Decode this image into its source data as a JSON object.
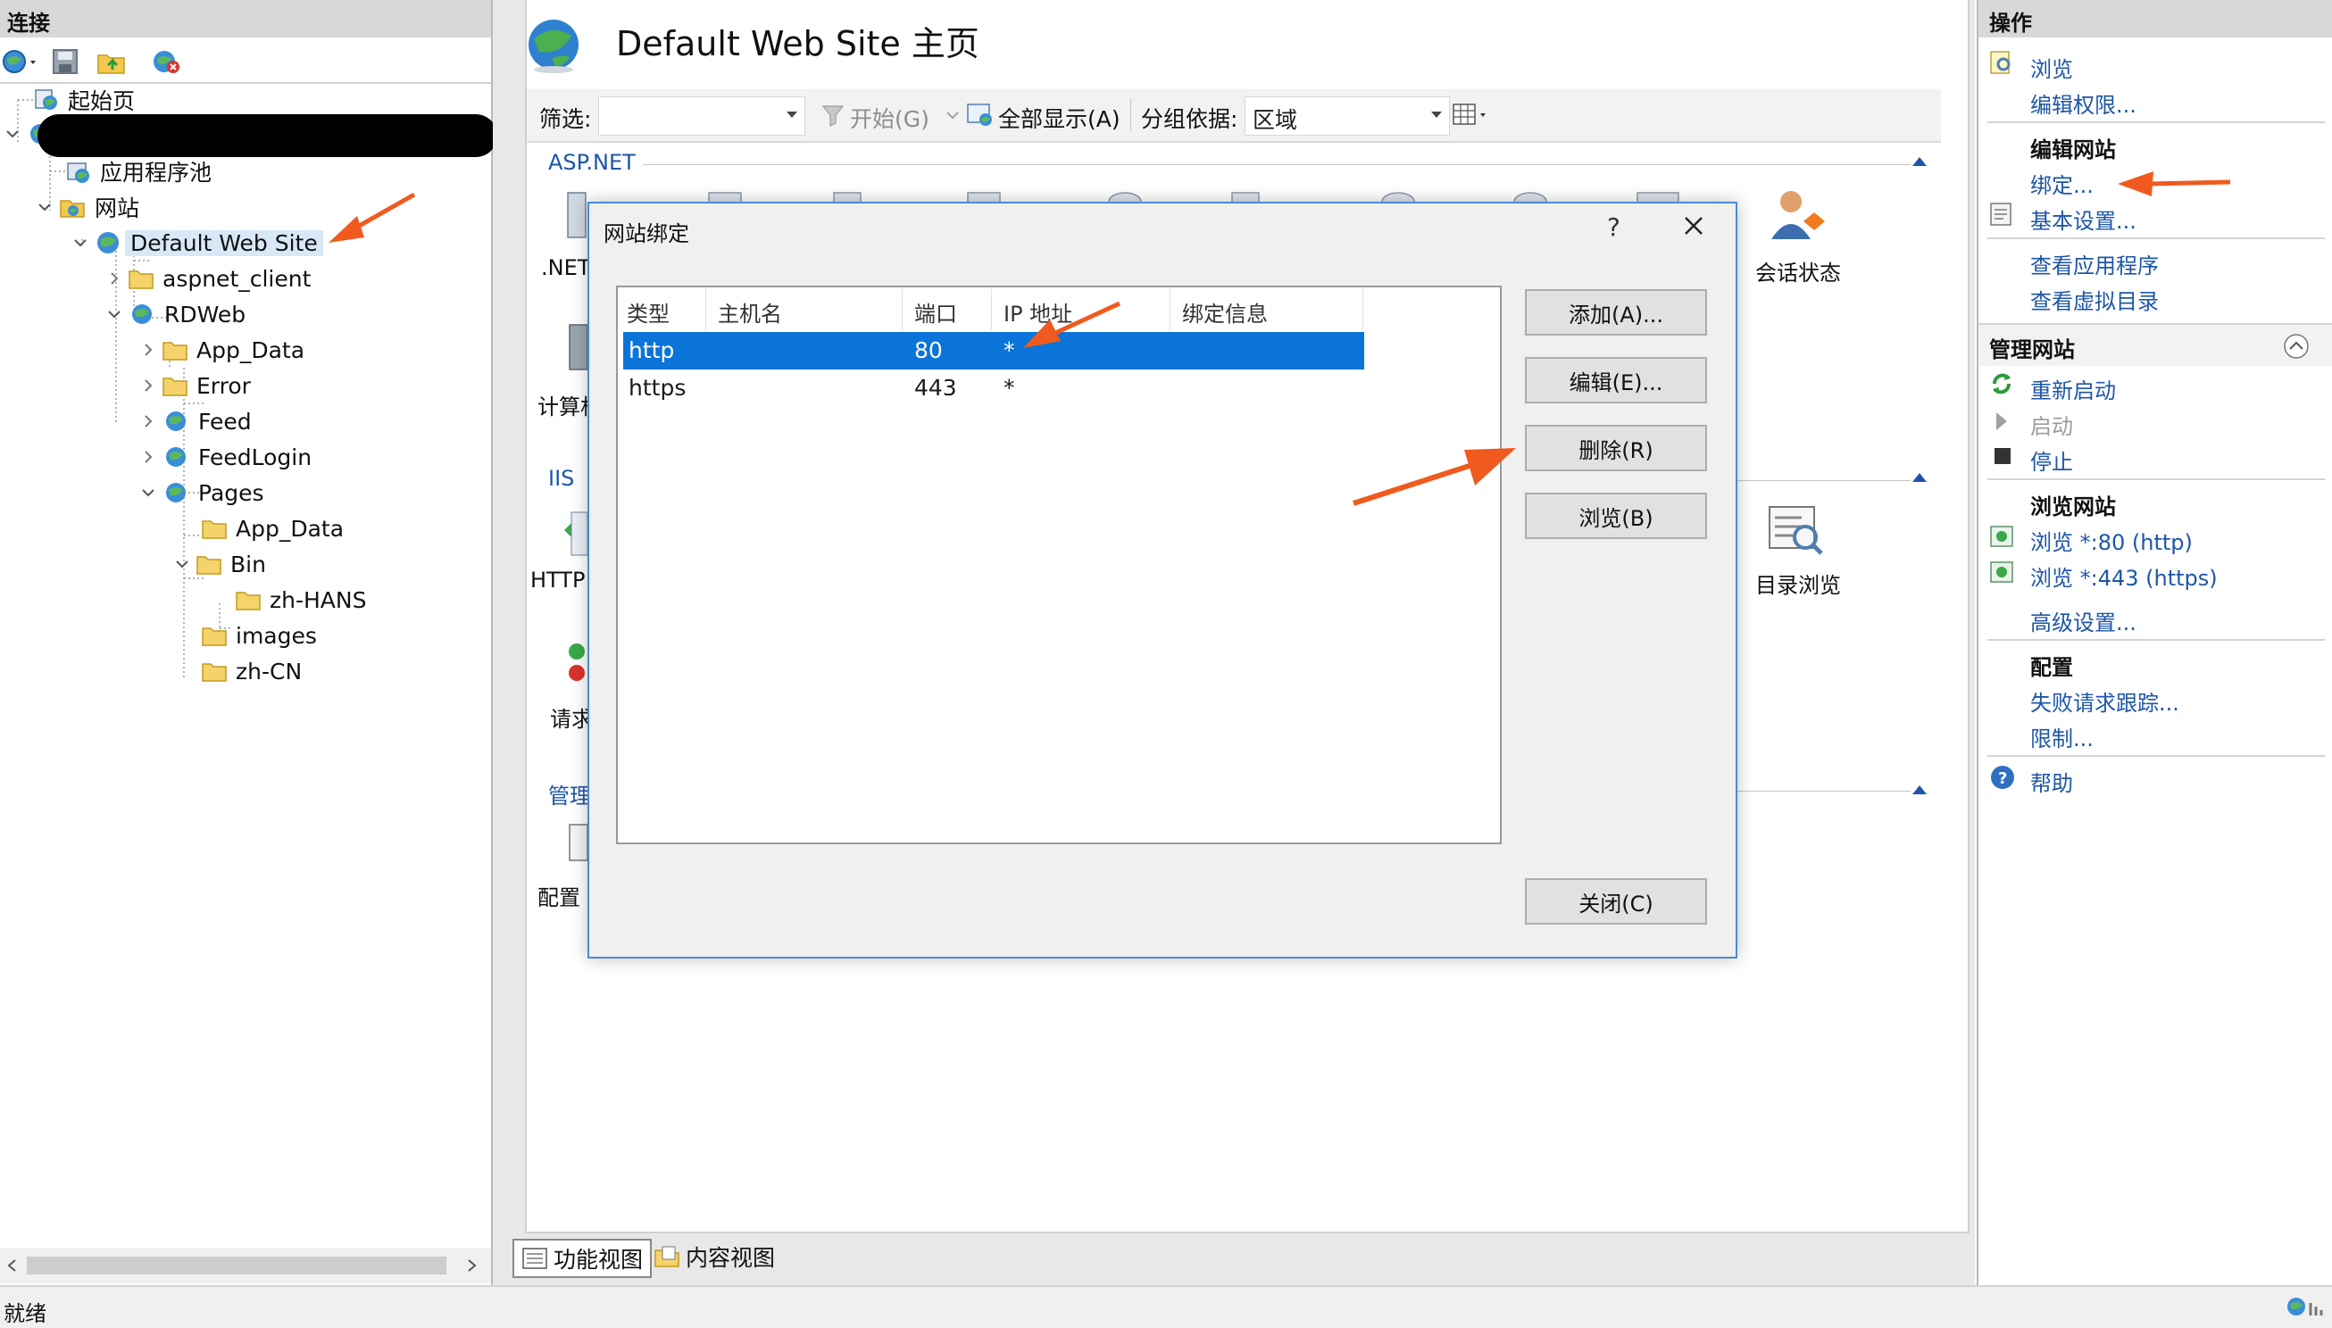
{
  "colors": {
    "accent_blue": "#1d56a8",
    "selection_blue": "#0a74d8",
    "annotation_arrow": "#f05a1e",
    "dialog_border": "#4a8ad8"
  },
  "left_pane": {
    "header": "连接",
    "tree": {
      "start_page": "起始页",
      "app_pools": "应用程序池",
      "sites": "网站",
      "default_site": "Default Web Site",
      "aspnet_client": "aspnet_client",
      "rdweb": "RDWeb",
      "app_data": "App_Data",
      "error": "Error",
      "feed": "Feed",
      "feedlogin": "FeedLogin",
      "pages": "Pages",
      "pages_app_data": "App_Data",
      "bin": "Bin",
      "zh_hans": "zh-HANS",
      "images": "images",
      "zh_cn": "zh-CN"
    }
  },
  "center": {
    "title": "Default Web Site 主页",
    "filter": {
      "label": "筛选:",
      "start": "开始(G)",
      "show_all": "全部显示(A)",
      "group_by_label": "分组依据:",
      "group_by_value": "区域"
    },
    "sections": {
      "aspnet": "ASP.NET",
      "iis": "IIS",
      "management": "管理"
    },
    "features": {
      "net_partial": ".NET",
      "computer_partial": "计算机",
      "session_state": "会话状态",
      "http_partial": "HTTP",
      "dir_browse": "目录浏览",
      "request_partial": "请求",
      "config_partial": "配置"
    },
    "bottom_tabs": {
      "feature_view": "功能视图",
      "content_view": "内容视图"
    }
  },
  "right_pane": {
    "header": "操作",
    "browse": "浏览",
    "edit_permissions": "编辑权限...",
    "edit_site_head": "编辑网站",
    "bindings": "绑定...",
    "basic_settings": "基本设置...",
    "view_apps": "查看应用程序",
    "view_vdirs": "查看虚拟目录",
    "manage_site_head": "管理网站",
    "restart": "重新启动",
    "start": "启动",
    "stop": "停止",
    "browse_site_head": "浏览网站",
    "browse_80": "浏览 *:80 (http)",
    "browse_443": "浏览 *:443 (https)",
    "advanced_settings": "高级设置...",
    "config_head": "配置",
    "failed_request_tracing": "失败请求跟踪...",
    "limits": "限制...",
    "help": "帮助"
  },
  "dialog": {
    "title": "网站绑定",
    "help": "?",
    "columns": {
      "type": "类型",
      "host": "主机名",
      "port": "端口",
      "ip": "IP 地址",
      "info": "绑定信息"
    },
    "rows": [
      {
        "type": "http",
        "host": "",
        "port": "80",
        "ip": "*",
        "info": ""
      },
      {
        "type": "https",
        "host": "",
        "port": "443",
        "ip": "*",
        "info": ""
      }
    ],
    "buttons": {
      "add": "添加(A)...",
      "edit": "编辑(E)...",
      "remove": "删除(R)",
      "browse": "浏览(B)",
      "close": "关闭(C)"
    }
  },
  "status_bar": {
    "text": "就绪"
  }
}
